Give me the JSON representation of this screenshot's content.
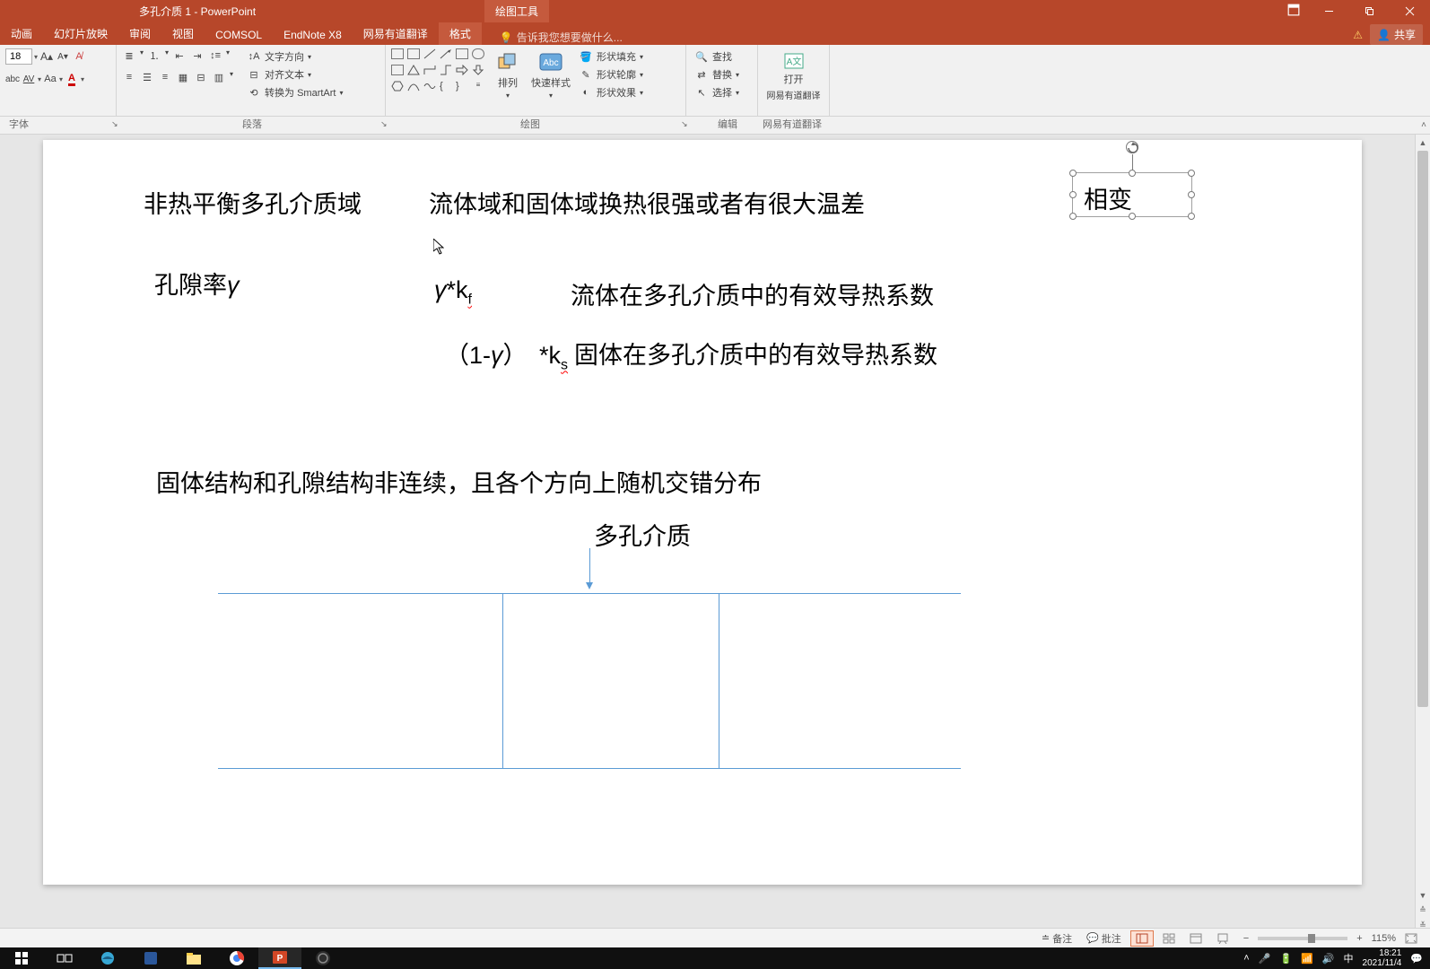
{
  "window": {
    "title": "多孔介质 1 - PowerPoint",
    "context_tab_group": "绘图工具"
  },
  "tabs": {
    "items": [
      "动画",
      "幻灯片放映",
      "审阅",
      "视图",
      "COMSOL",
      "EndNote X8",
      "网易有道翻译",
      "格式"
    ],
    "active_index": 7,
    "tellme_placeholder": "告诉我您想要做什么...",
    "share": "共享"
  },
  "ribbon": {
    "font_size": "18",
    "groups": {
      "font": "字体",
      "paragraph": "段落",
      "drawing": "绘图",
      "editing": "编辑",
      "yd": "网易有道翻译"
    },
    "para": {
      "text_direction": "文字方向",
      "align_text": "对齐文本",
      "convert_smartart": "转换为 SmartArt"
    },
    "draw": {
      "arrange": "排列",
      "quick_styles": "快速样式",
      "shape_fill": "形状填充",
      "shape_outline": "形状轮廓",
      "shape_effects": "形状效果"
    },
    "edit": {
      "find": "查找",
      "replace": "替换",
      "select": "选择"
    },
    "yd_btn": {
      "line1": "打开",
      "line2": "网易有道翻译"
    }
  },
  "slide": {
    "t1": "非热平衡多孔介质域",
    "t2": "流体域和固体域换热很强或者有很大温差",
    "t3": "相变",
    "t4a": "孔隙率",
    "t4b": "γ",
    "eq1a": "γ",
    "eq1b": "*k",
    "eq1c": "f",
    "eq1_desc": "流体在多孔介质中的有效导热系数",
    "eq2a": "（1-",
    "eq2b": "γ",
    "eq2c": "）",
    "eq2d": "*k",
    "eq2e": "s",
    "eq2_desc": "固体在多孔介质中的有效导热系数",
    "t5": "固体结构和孔隙结构非连续，且各个方向上随机交错分布",
    "t6": "多孔介质"
  },
  "status": {
    "notes": "备注",
    "comments": "批注",
    "zoom": "115%"
  },
  "tray": {
    "ime": "中",
    "time": "18:21",
    "date": "2021/11/4"
  }
}
